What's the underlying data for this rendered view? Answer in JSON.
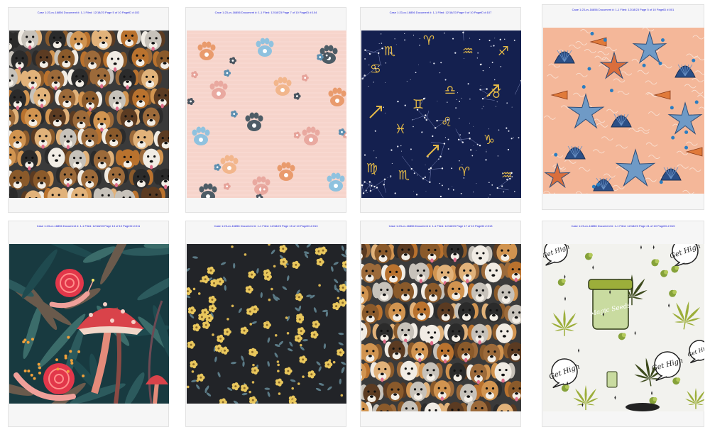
{
  "cards": [
    {
      "header": "Case 1:23-cv-16856 Document #: 1-1 Filed: 12/18/23 Page 5 of 10 PageID #:102",
      "pattern": "dogs-crowd"
    },
    {
      "header": "Case 1:23-cv-16856 Document #: 1-1 Filed: 12/18/23 Page 7 of 10 PageID #:104",
      "pattern": "paw-prints-pink"
    },
    {
      "header": "Case 1:23-cv-16856 Document #: 1-1 Filed: 12/18/23 Page 9 of 10 PageID #:107",
      "pattern": "zodiac-navy"
    },
    {
      "header": "Case 1:23-cv-16856 Document #: 1-1 Filed: 12/18/23 Page 5 of 10 PageID #:001",
      "pattern": "seashells-starfish"
    },
    {
      "header": "Case 1:23-cv-16856 Document #: 1-1 Filed: 12/18/23 Page 13 of 10 PageID #:011",
      "pattern": "snails-mushrooms"
    },
    {
      "header": "Case 1:23-cv-16856 Document #: 1-1 Filed: 12/18/23 Page 15 of 10 PageID #:013",
      "pattern": "yellow-flowers-dark"
    },
    {
      "header": "Case 1:23-cv-16856 Document #: 1-1 Filed: 12/18/23 Page 17 of 10 PageID #:013",
      "pattern": "dogs-crowd-2"
    },
    {
      "header": "Case 1:23-cv-16856 Document #: 1-1 Filed: 12/18/23 Page 21 of 10 PageID #:015",
      "pattern": "cannabis-get-high"
    }
  ],
  "colors": {
    "dogs_bg": "#3a3a3a",
    "paw_bg": "#f6d4cb",
    "zodiac_bg": "#14204f",
    "zodiac_gold": "#e2b848",
    "shells_bg": "#f4b799",
    "snails_bg": "#183a40",
    "flowers_bg": "#222428",
    "cannabis_bg": "#f2f2ee"
  },
  "cannabis": {
    "bubble_text": "Get High",
    "jar_text": "Magic Seeds"
  }
}
